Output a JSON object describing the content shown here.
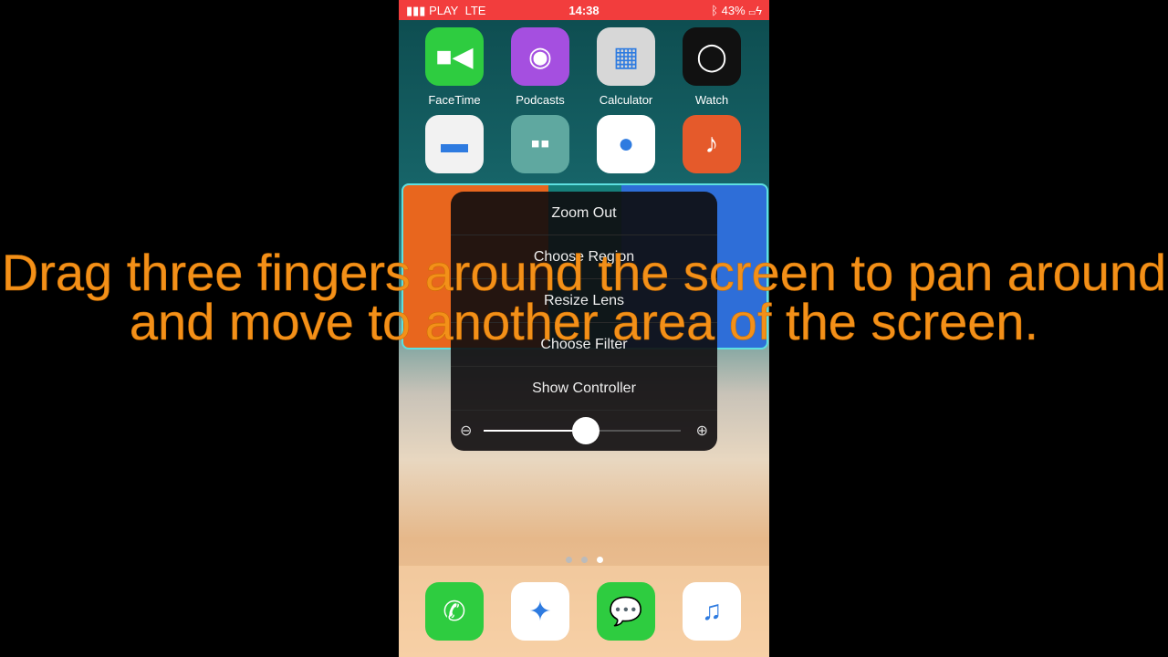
{
  "status": {
    "carrier": "PLAY",
    "network": "LTE",
    "time": "14:38",
    "battery": "43%",
    "bluetooth_icon": "bluetooth-icon",
    "charging_icon": "bolt-icon"
  },
  "apps_row1": [
    {
      "label": "FaceTime",
      "color": "#2ecc40",
      "icon": "video-camera"
    },
    {
      "label": "Podcasts",
      "color": "#a54fe0",
      "icon": "podcast"
    },
    {
      "label": "Calculator",
      "color": "#d7d7d7",
      "icon": "calculator"
    },
    {
      "label": "Watch",
      "color": "#111111",
      "icon": "watch"
    }
  ],
  "apps_row2": [
    {
      "color": "#f2f2f2",
      "icon": "folder"
    },
    {
      "color": "#5fa8a0",
      "icon": "folder-grid"
    },
    {
      "color": "#ffffff",
      "icon": "video-circle"
    },
    {
      "color": "#e55a2b",
      "icon": "guitar"
    }
  ],
  "zoom_menu": {
    "items": [
      "Zoom Out",
      "Choose Region",
      "Resize Lens",
      "Choose Filter",
      "Show Controller"
    ],
    "zoom_level": 0.52
  },
  "dock": [
    {
      "icon": "phone",
      "color": "#2ecc40"
    },
    {
      "icon": "compass",
      "color": "#ffffff"
    },
    {
      "icon": "message",
      "color": "#2ecc40"
    },
    {
      "icon": "music-note",
      "color": "#ffffff"
    }
  ],
  "page_indicator": {
    "pages": 3,
    "current": 3
  },
  "caption": "Drag three fingers around the screen to pan around and move to another area of the screen."
}
